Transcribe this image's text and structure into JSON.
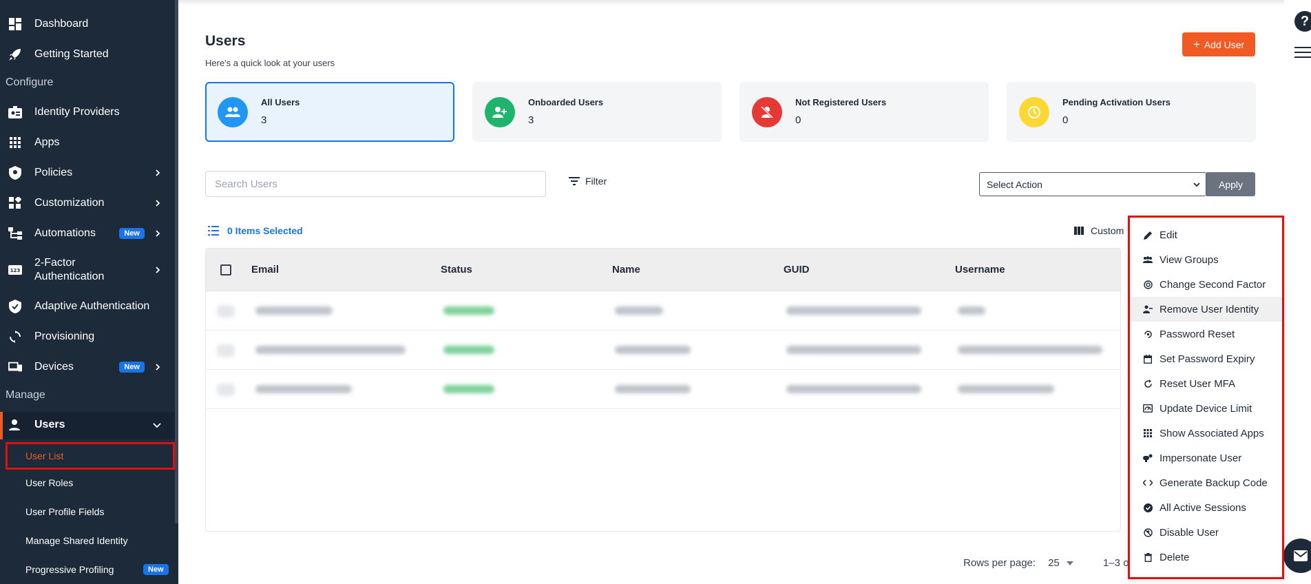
{
  "sidebar": {
    "top_items": [
      {
        "label": "Dashboard",
        "icon": "dashboard-icon"
      },
      {
        "label": "Getting Started",
        "icon": "rocket-icon"
      }
    ],
    "section_configure": "Configure",
    "configure_items": [
      {
        "label": "Identity Providers",
        "icon": "id-badge-icon"
      },
      {
        "label": "Apps",
        "icon": "apps-grid-icon"
      },
      {
        "label": "Policies",
        "icon": "shield-icon"
      },
      {
        "label": "Customization",
        "icon": "widgets-icon"
      },
      {
        "label": "Automations",
        "icon": "flow-icon",
        "badge": "New"
      },
      {
        "label": "2-Factor",
        "label2": "Authentication",
        "icon": "123-icon"
      },
      {
        "label": "Adaptive Authentication",
        "icon": "shield-check-icon"
      },
      {
        "label": "Provisioning",
        "icon": "sync-icon"
      },
      {
        "label": "Devices",
        "icon": "devices-icon",
        "badge": "New"
      }
    ],
    "section_manage": "Manage",
    "users_label": "Users",
    "users_sub": [
      "User List",
      "User Roles",
      "User Profile Fields",
      "Manage Shared Identity",
      "Progressive Profiling"
    ],
    "progressive_badge": "New"
  },
  "header": {
    "title": "Users",
    "subtitle": "Here's a quick look at your users",
    "add_user": "Add User"
  },
  "cards": [
    {
      "title": "All Users",
      "value": "3",
      "color": "#2196f3"
    },
    {
      "title": "Onboarded Users",
      "value": "3",
      "color": "#1fb36b"
    },
    {
      "title": "Not Registered Users",
      "value": "0",
      "color": "#e53935"
    },
    {
      "title": "Pending Activation Users",
      "value": "0",
      "color": "#fdd835"
    }
  ],
  "toolbar": {
    "search_placeholder": "Search Users",
    "filter": "Filter",
    "select_action": "Select Action",
    "apply": "Apply",
    "items_selected": "0 Items Selected",
    "customize": "Custom"
  },
  "table": {
    "columns": [
      "Email",
      "Status",
      "Name",
      "GUID",
      "Username"
    ]
  },
  "pagination": {
    "rows_per_page_label": "Rows per page:",
    "rows_per_page_value": "25",
    "range": "1–3 o"
  },
  "menu": {
    "items": [
      {
        "label": "Edit",
        "icon": "pencil-icon"
      },
      {
        "label": "View Groups",
        "icon": "groups-icon"
      },
      {
        "label": "Change Second Factor",
        "icon": "second-factor-icon"
      },
      {
        "label": "Remove User Identity",
        "icon": "person-remove-icon"
      },
      {
        "label": "Password Reset",
        "icon": "lock-reset-icon"
      },
      {
        "label": "Set Password Expiry",
        "icon": "calendar-icon"
      },
      {
        "label": "Reset User MFA",
        "icon": "refresh-icon"
      },
      {
        "label": "Update Device Limit",
        "icon": "device-limit-icon"
      },
      {
        "label": "Show Associated Apps",
        "icon": "apps-dots-icon"
      },
      {
        "label": "Impersonate User",
        "icon": "impersonate-icon"
      },
      {
        "label": "Generate Backup Code",
        "icon": "code-icon"
      },
      {
        "label": "All Active Sessions",
        "icon": "check-circle-icon"
      },
      {
        "label": "Disable User",
        "icon": "disable-icon"
      },
      {
        "label": "Delete",
        "icon": "trash-icon"
      }
    ]
  }
}
